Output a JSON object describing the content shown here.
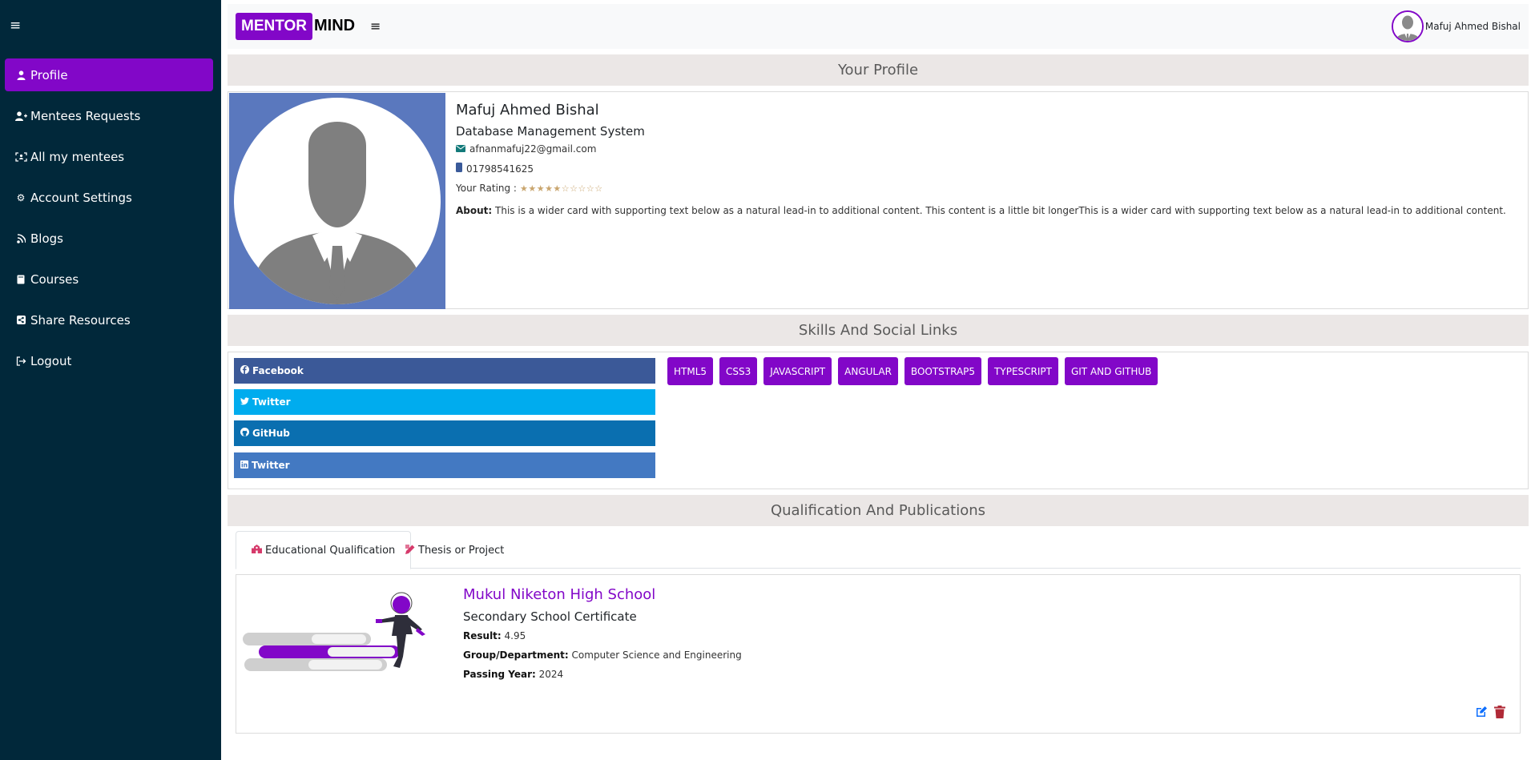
{
  "sidebar": {
    "toggle_icon": "≡",
    "items": [
      {
        "icon": "user-icon",
        "label": "Profile",
        "active": true
      },
      {
        "icon": "user-plus-icon",
        "label": "Mentees Requests"
      },
      {
        "icon": "users-viewfinder-icon",
        "label": "All my mentees"
      },
      {
        "icon": "gear-icon",
        "label": "Account Settings"
      },
      {
        "icon": "blog-icon",
        "label": "Blogs"
      },
      {
        "icon": "book-icon",
        "label": "Courses"
      },
      {
        "icon": "share-icon",
        "label": "Share Resources"
      },
      {
        "icon": "logout-icon",
        "label": "Logout"
      }
    ]
  },
  "header": {
    "logo_box": "MENTOR",
    "logo_rest": "MIND",
    "menu_icon": "≡",
    "user_name": "Mafuj Ahmed Bishal"
  },
  "sections": {
    "profile": "Your Profile",
    "skills": "Skills And Social Links",
    "qualification": "Qualification And Publications"
  },
  "profile": {
    "name": "Mafuj Ahmed Bishal",
    "title": "Database Management System",
    "email": "afnanmafuj22@gmail.com",
    "phone": "01798541625",
    "rating_label": "Your Rating :",
    "rating": "★★★★★☆☆☆☆☆",
    "about_label": "About:",
    "about_text": "This is a wider card with supporting text below as a natural lead-in to additional content. This content is a little bit longerThis is a wider card with supporting text below as a natural lead-in to additional content."
  },
  "social_links": [
    {
      "label": "Facebook",
      "icon": "facebook-icon",
      "color": "#3b5998"
    },
    {
      "label": "Twitter",
      "icon": "twitter-icon",
      "color": "#00acee"
    },
    {
      "label": "GitHub",
      "icon": "github-icon",
      "color": "#0a6fb0"
    },
    {
      "label": "Twitter",
      "icon": "linkedin-icon",
      "color": "#4379c2"
    }
  ],
  "skills": [
    "HTML5",
    "CSS3",
    "JAVASCRIPT",
    "ANGULAR",
    "BOOTSTRAP5",
    "TYPESCRIPT",
    "GIT AND GITHUB"
  ],
  "tabs": [
    {
      "label": "Educational Qualification",
      "icon": "school-icon",
      "active": true
    },
    {
      "label": "Thesis or Project",
      "icon": "pen-ruler-icon"
    }
  ],
  "qualification": {
    "school": "Mukul Niketon High School",
    "certificate": "Secondary School Certificate",
    "result_label": "Result:",
    "result": "4.95",
    "group_label": "Group/Department:",
    "group": "Computer Science and Engineering",
    "year_label": "Passing Year:",
    "year": "2024"
  },
  "colors": {
    "accent": "#8207c8",
    "sidebar_bg": "#01283a",
    "section_header_bg": "#ebe7e6",
    "edit": "#0d6efd",
    "delete": "#b02a37"
  }
}
